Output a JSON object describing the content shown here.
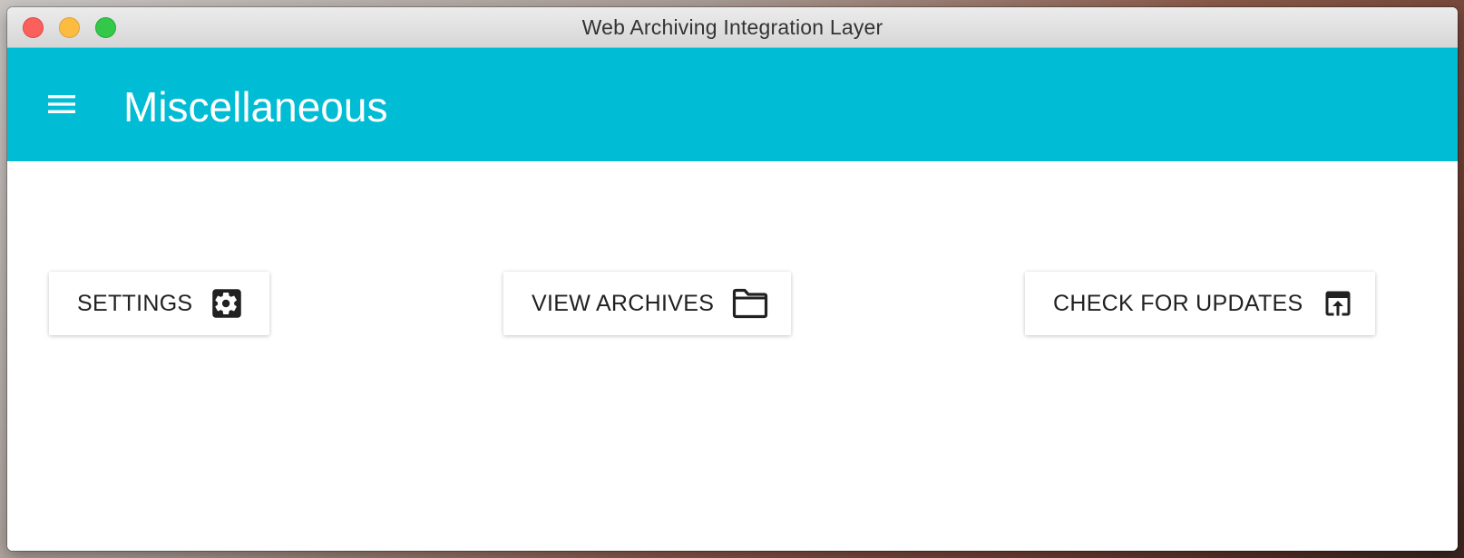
{
  "window": {
    "title": "Web Archiving Integration Layer",
    "controls": [
      "close",
      "minimize",
      "zoom"
    ]
  },
  "appbar": {
    "color": "#00bcd4",
    "menu_icon": "menu-icon",
    "title": "Miscellaneous"
  },
  "actions": [
    {
      "label": "SETTINGS",
      "icon": "gear-icon"
    },
    {
      "label": "VIEW ARCHIVES",
      "icon": "folder-icon"
    },
    {
      "label": "CHECK FOR UPDATES",
      "icon": "open-in-browser-icon"
    }
  ]
}
